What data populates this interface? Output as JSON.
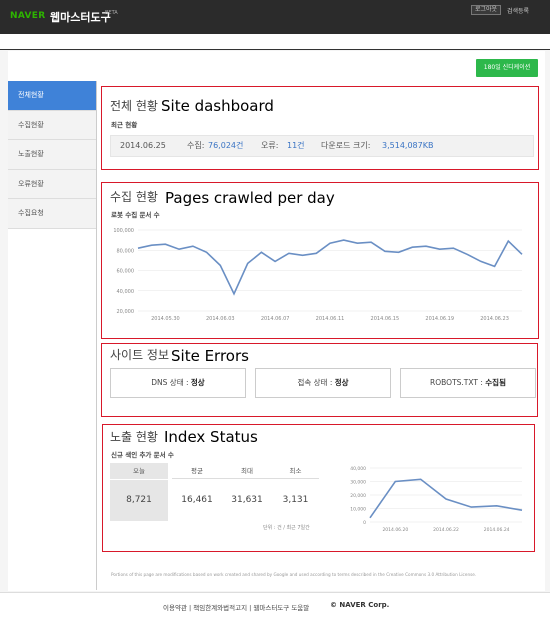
{
  "header": {
    "logo": "NAVER",
    "title": "웹마스터도구",
    "beta": "BETA",
    "login_label": "로그아웃",
    "search_register_label": "검색등록"
  },
  "action_button_label": "180일 신디케이션",
  "sidebar": {
    "items": [
      {
        "label": "전체현황",
        "active": true
      },
      {
        "label": "수집현황",
        "active": false
      },
      {
        "label": "노출현황",
        "active": false
      },
      {
        "label": "오류현황",
        "active": false
      },
      {
        "label": "수집요청",
        "active": false
      }
    ]
  },
  "dashboard": {
    "title": "전체 현황",
    "overlay": "Site dashboard",
    "subtitle": "최근 현황",
    "date": "2014.06.25",
    "collect_label": "수집:",
    "collect_value": "76,024건",
    "error_label": "오류:",
    "error_value": "11건",
    "download_label": "다운로드 크기:",
    "download_value": "3,514,087KB"
  },
  "crawl": {
    "title": "수집 현황",
    "overlay": "Pages crawled per day",
    "subtitle": "로봇 수집 문서 수"
  },
  "site_info": {
    "title": "사이트 정보",
    "overlay": "Site Errors",
    "dns": "DNS 상태 : ",
    "dns_value": "정상",
    "conn": "접속 상태 : ",
    "conn_value": "정상",
    "robots": "ROBOTS.TXT : ",
    "robots_value": "수집됨"
  },
  "index": {
    "title": "노출 현황",
    "overlay": "Index Status",
    "subtitle": "신규 색인 추가 문서 수",
    "headers": [
      "오늘",
      "평균",
      "최대",
      "최소"
    ],
    "values": [
      "8,721",
      "16,461",
      "31,631",
      "3,131"
    ],
    "note": "단위 : 건 / 최근 7일간"
  },
  "disclaimer": "Portions of this page are modifications based on work created and shared by Google and used according to terms described in the Creative Commons 3.0 Attribution License.",
  "footer": {
    "links": "이용약관 | 책임한계와법적고지 | 웹마스터도구 도움말",
    "copyright": "© NAVER Corp."
  },
  "chart_data": [
    {
      "type": "line",
      "x": [
        "2014.05.29",
        "2014.05.30",
        "2014.05.31",
        "2014.06.01",
        "2014.06.02",
        "2014.06.03",
        "2014.06.04",
        "2014.06.05",
        "2014.06.06",
        "2014.06.07",
        "2014.06.08",
        "2014.06.09",
        "2014.06.10",
        "2014.06.11",
        "2014.06.12",
        "2014.06.13",
        "2014.06.14",
        "2014.06.15",
        "2014.06.16",
        "2014.06.17",
        "2014.06.18",
        "2014.06.19",
        "2014.06.20",
        "2014.06.21",
        "2014.06.22",
        "2014.06.23",
        "2014.06.24",
        "2014.06.25"
      ],
      "values": [
        82000,
        85000,
        86000,
        81000,
        84000,
        78000,
        65000,
        37000,
        67000,
        78000,
        69000,
        77000,
        75000,
        77000,
        87000,
        90000,
        87000,
        88000,
        79000,
        78000,
        83000,
        84000,
        81000,
        82000,
        76000,
        69000,
        64000,
        89000,
        76000
      ],
      "yticks": [
        "100,000",
        "80,000",
        "60,000",
        "40,000",
        "20,000"
      ],
      "xtick_labels": [
        "2014.05.30",
        "2014.06.03",
        "2014.06.07",
        "2014.06.11",
        "2014.06.15",
        "2014.06.19",
        "2014.06.23"
      ],
      "ylim": [
        20000,
        100000
      ],
      "color": "#6a8fc4",
      "grid": true
    },
    {
      "type": "line",
      "x": [
        "2014.06.19",
        "2014.06.20",
        "2014.06.21",
        "2014.06.22",
        "2014.06.23",
        "2014.06.24",
        "2014.06.25"
      ],
      "values": [
        3131,
        30000,
        31631,
        17000,
        11000,
        12000,
        8721
      ],
      "yticks": [
        "40,000",
        "30,000",
        "20,000",
        "10,000",
        "0"
      ],
      "xtick_labels": [
        "2014.06.20",
        "2014.06.22",
        "2014.06.24"
      ],
      "ylim": [
        0,
        40000
      ],
      "color": "#6a8fc4",
      "grid": true
    }
  ]
}
